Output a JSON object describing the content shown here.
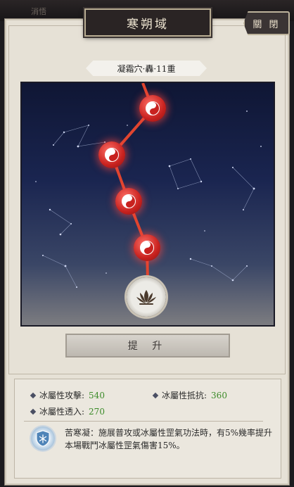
{
  "top": {
    "ghost_text": "消悟"
  },
  "header": {
    "title": "寒朔域",
    "close_label": "關 閉"
  },
  "constellation": {
    "subtitle": "凝霜穴·轟·11重"
  },
  "upgrade": {
    "label": "提 升"
  },
  "stats": {
    "ice_attack": {
      "label": "冰屬性攻擊:",
      "value": "540"
    },
    "ice_resist": {
      "label": "冰屬性抵抗:",
      "value": "360"
    },
    "ice_penetration": {
      "label": "冰屬性透入:",
      "value": "270"
    }
  },
  "skill": {
    "text": "苦寒凝：施展普攻或冰屬性罡氣功法時，有5%幾率提升本場戰鬥冰屬性罡氣傷害15%。"
  }
}
